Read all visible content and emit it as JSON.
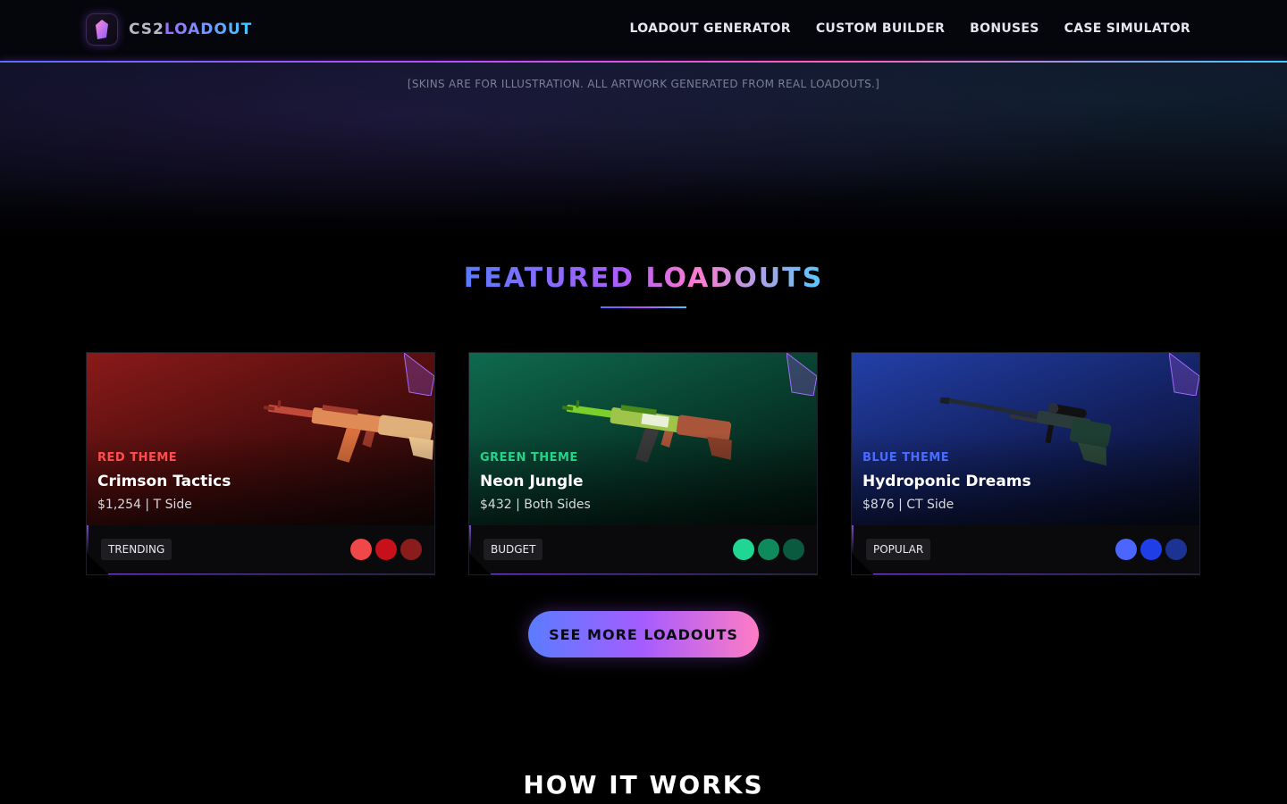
{
  "brand": {
    "part1": "CS2",
    "part2": "LOADOUT"
  },
  "nav": [
    {
      "label": "LOADOUT GENERATOR"
    },
    {
      "label": "CUSTOM BUILDER"
    },
    {
      "label": "BONUSES"
    },
    {
      "label": "CASE SIMULATOR"
    }
  ],
  "hero": {
    "disclaimer": "[SKINS ARE FOR ILLUSTRATION. ALL ARTWORK GENERATED FROM REAL LOADOUTS.]"
  },
  "featured": {
    "title": "FEATURED LOADOUTS",
    "cards": [
      {
        "theme": "RED THEME",
        "theme_color": "#ff4d4d",
        "name": "Crimson Tactics",
        "meta": "$1,254 | T Side",
        "badge": "TRENDING",
        "weapon_icon": "ak47-icon",
        "swatches": [
          "#f04848",
          "#c8101a",
          "#8a1c1c"
        ]
      },
      {
        "theme": "GREEN THEME",
        "theme_color": "#22d38a",
        "name": "Neon Jungle",
        "meta": "$432 | Both Sides",
        "badge": "BUDGET",
        "weapon_icon": "ak47-icon",
        "swatches": [
          "#1fd693",
          "#0e8a5c",
          "#0a5a40"
        ]
      },
      {
        "theme": "BLUE THEME",
        "theme_color": "#4a6bff",
        "name": "Hydroponic Dreams",
        "meta": "$876 | CT Side",
        "badge": "POPULAR",
        "weapon_icon": "sniper-rifle-icon",
        "swatches": [
          "#4b66ff",
          "#1f3ee8",
          "#1d3394"
        ]
      }
    ]
  },
  "cta": {
    "label": "SEE MORE LOADOUTS"
  },
  "how": {
    "title": "HOW IT WORKS"
  }
}
